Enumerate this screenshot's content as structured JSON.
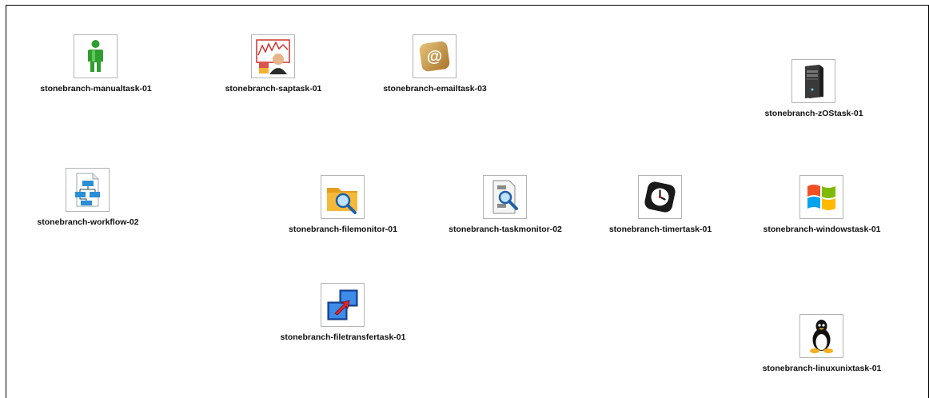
{
  "tasks": [
    {
      "label": "stonebranch-manualtask-01",
      "icon": "manual-person-icon"
    },
    {
      "label": "stonebranch-saptask-01",
      "icon": "sap-chart-user-icon"
    },
    {
      "label": "stonebranch-emailtask-03",
      "icon": "email-at-icon"
    },
    {
      "label": "stonebranch-zOStask-01",
      "icon": "server-tower-icon"
    },
    {
      "label": "stonebranch-workflow-02",
      "icon": "workflow-diagram-icon"
    },
    {
      "label": "stonebranch-filemonitor-01",
      "icon": "folder-magnifier-icon"
    },
    {
      "label": "stonebranch-taskmonitor-02",
      "icon": "task-monitor-icon"
    },
    {
      "label": "stonebranch-timertask-01",
      "icon": "clock-icon"
    },
    {
      "label": "stonebranch-windowstask-01",
      "icon": "windows-logo-icon"
    },
    {
      "label": "stonebranch-filetransfertask-01",
      "icon": "file-transfer-icon"
    },
    {
      "label": "stonebranch-linuxunixtask-01",
      "icon": "linux-penguin-icon"
    }
  ],
  "colors": {
    "frame_border": "#000000",
    "tile_border": "#b4b4b4",
    "label_text": "#111111"
  }
}
